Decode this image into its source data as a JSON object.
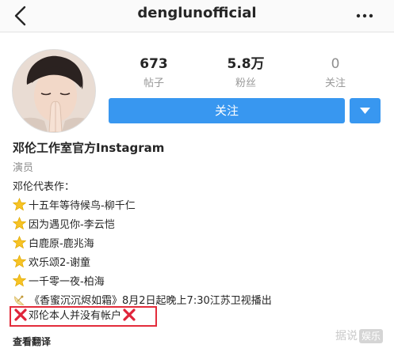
{
  "header": {
    "username": "denglunofficial"
  },
  "stats": [
    {
      "value": "673",
      "label": "帖子"
    },
    {
      "value": "5.8万",
      "label": "粉丝"
    },
    {
      "value": "0",
      "label": "关注"
    }
  ],
  "actions": {
    "follow_label": "关注"
  },
  "profile": {
    "name": "邓伦工作室官方Instagram",
    "occupation": "演员",
    "works_heading": "邓伦代表作：",
    "works": [
      "十五年等待候鸟-柳千仁",
      "因为遇见你-李云恺",
      "白鹿原-鹿兆海",
      "欢乐颂2-谢童",
      "一千零一夜-柏海"
    ],
    "broadcast": "《香蜜沉沉烬如霜》8月2日起晚上7:30江苏卫视播出",
    "disclaimer": "邓伦本人并没有帐户"
  },
  "footer": {
    "translate": "查看翻译"
  },
  "watermark": {
    "text": "据说",
    "badge": "娱乐"
  },
  "colors": {
    "accent": "#3897f0",
    "highlight_border": "#e32c3b"
  }
}
